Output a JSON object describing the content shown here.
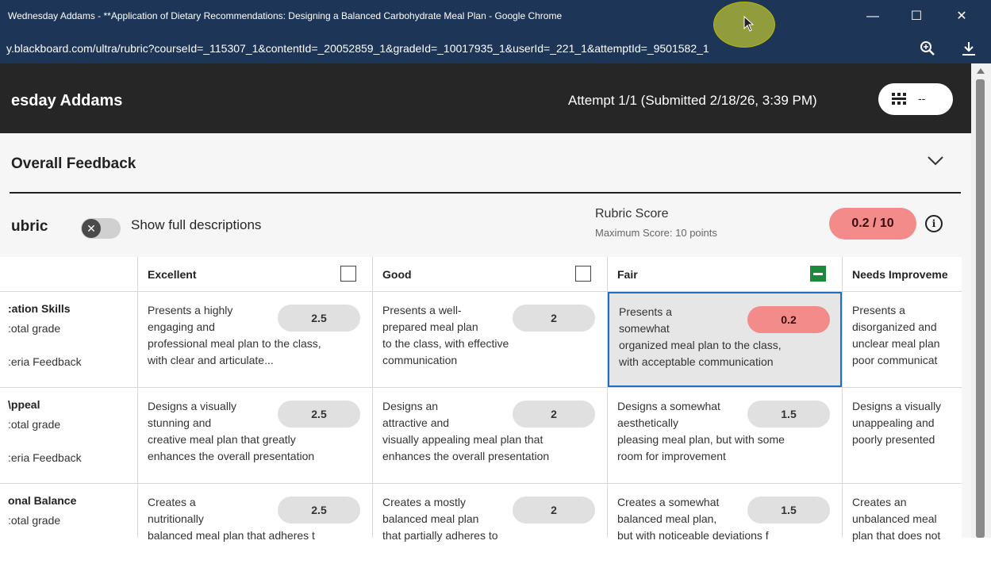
{
  "browser": {
    "title": "Wednesday Addams - **Application of Dietary Recommendations: Designing a Balanced Carbohydrate Meal Plan - Google Chrome",
    "url": "y.blackboard.com/ultra/rubric?courseId=_115307_1&contentId=_20052859_1&gradeId=_10017935_1&userId=_221_1&attemptId=_9501582_1",
    "minimize": "—",
    "maximize": "☐",
    "close": "✕"
  },
  "header": {
    "student_name": "esday Addams",
    "attempt": "Attempt 1/1 (Submitted 2/18/26, 3:39 PM)",
    "grade_pill": "--"
  },
  "feedback": {
    "title": "Overall Feedback"
  },
  "rubric": {
    "title": "ubric",
    "toggle_label": "Show full descriptions",
    "toggle_on": false,
    "score_title": "Rubric Score",
    "max_score": "Maximum Score: 10 points",
    "score": "0.2 / 10",
    "info_icon": "i",
    "columns": [
      {
        "label": "Excellent",
        "checked": false
      },
      {
        "label": "Good",
        "checked": false
      },
      {
        "label": "Fair",
        "checked": true
      },
      {
        "label": "Needs Improveme",
        "checked": false
      }
    ],
    "rows": [
      {
        "criterion": ":ation Skills",
        "sub": ":otal grade",
        "feedback": ":eria Feedback",
        "cells": [
          {
            "text": "Presents a highly\nengaging and\nprofessional meal plan to the class,\nwith clear and articulate...",
            "score": "2.5",
            "selected": false
          },
          {
            "text": "Presents a well-\nprepared meal plan\nto the class, with effective\ncommunication",
            "score": "2",
            "selected": false
          },
          {
            "text": "Presents a\nsomewhat\norganized meal plan to the class,\nwith acceptable communication",
            "score": "0.2",
            "selected": true
          },
          {
            "text": "Presents a\ndisorganized and\nunclear meal plan\npoor communicat",
            "score": "",
            "selected": false
          }
        ]
      },
      {
        "criterion": "\\ppeal",
        "sub": ":otal grade",
        "feedback": ":eria Feedback",
        "cells": [
          {
            "text": "Designs a visually\nstunning and\ncreative meal plan that greatly\nenhances the overall presentation",
            "score": "2.5",
            "selected": false
          },
          {
            "text": "Designs an\nattractive and\nvisually appealing meal plan that\nenhances the overall presentation",
            "score": "2",
            "selected": false
          },
          {
            "text": "Designs a somewhat\naesthetically\npleasing meal plan, but with some\nroom for improvement",
            "score": "1.5",
            "selected": false
          },
          {
            "text": "Designs a visually\nunappealing and\npoorly presented",
            "score": "",
            "selected": false
          }
        ]
      },
      {
        "criterion": "onal Balance",
        "sub": ":otal grade",
        "feedback": "",
        "cells": [
          {
            "text": "Creates a\nnutritionally\nbalanced meal plan that adheres t",
            "score": "2.5",
            "selected": false
          },
          {
            "text": "Creates a mostly\nbalanced meal plan\nthat partially adheres to",
            "score": "2",
            "selected": false
          },
          {
            "text": "Creates a somewhat\nbalanced meal plan,\nbut with noticeable deviations f",
            "score": "1.5",
            "selected": false
          },
          {
            "text": "Creates an\nunbalanced meal\nplan that does not",
            "score": "",
            "selected": false
          }
        ]
      }
    ]
  }
}
